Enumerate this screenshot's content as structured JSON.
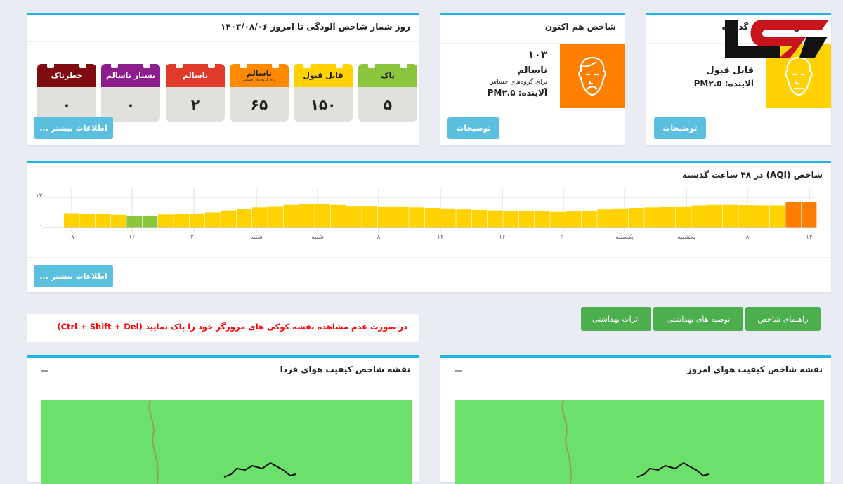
{
  "counter": {
    "title": "روز شمار شاخص آلودگی تا امروز ۱۴۰۳/۰۸/۰۶",
    "more_label": "اطلاعات بیشتر ...",
    "tiles": [
      {
        "label": "پاک",
        "sub": "",
        "value": "۵",
        "color": "#8cc63f",
        "text": "#222"
      },
      {
        "label": "قابل قبول",
        "sub": "",
        "value": "۱۵۰",
        "color": "#ffd200",
        "text": "#222"
      },
      {
        "label": "ناسالم",
        "sub": "برای گروه های حساس",
        "value": "۶۵",
        "color": "#ff8a00",
        "text": "#222"
      },
      {
        "label": "ناسالم",
        "sub": "",
        "value": "۲",
        "color": "#e03a2a",
        "text": "#fff"
      },
      {
        "label": "بسیار ناسالم",
        "sub": "",
        "value": "۰",
        "color": "#8e1e8e",
        "text": "#fff"
      },
      {
        "label": "خطرناک",
        "sub": "",
        "value": "۰",
        "color": "#7e0c10",
        "text": "#fff"
      }
    ]
  },
  "now": {
    "title": "شاخص هم اکنون",
    "value": "۱۰۳",
    "status": "ناسالم",
    "group": "برای گروه‌های حساس",
    "pollutant": "آلاینده: PM۲.۵",
    "button": "توضیحات",
    "color": "#ff8000",
    "face": "sad-face-icon"
  },
  "past24": {
    "title": "شاخص ۲۴ ساعت گذشته",
    "status": "قابل قبول",
    "pollutant": "آلاینده: PM۲.۵",
    "button": "توضیحات",
    "color": "#ffd200",
    "face": "neutral-face-icon"
  },
  "logo": {
    "text": "رکنا"
  },
  "chart_data": {
    "type": "bar",
    "title": "شاخص (AQI) در ۴۸ ساعت گذشته",
    "ylim": [
      0,
      120
    ],
    "yticks": [
      "۰",
      "۱۲۰"
    ],
    "xticks": [
      "۱۷",
      "۱۶",
      "۲۰",
      "شنبه",
      "شنبه",
      "۸",
      "۱۲",
      "۱۶",
      "۲۰",
      "یکشنبه",
      "یکشنبه",
      "۸",
      "۱۲"
    ],
    "values": [
      57,
      55,
      53,
      51,
      45,
      46,
      52,
      54,
      56,
      60,
      68,
      75,
      80,
      85,
      90,
      92,
      92,
      90,
      86,
      86,
      84,
      84,
      80,
      78,
      76,
      72,
      70,
      68,
      66,
      65,
      65,
      62,
      64,
      66,
      72,
      76,
      78,
      80,
      82,
      84,
      88,
      90,
      90,
      89,
      88,
      88,
      103,
      103
    ],
    "colors": {
      "good": "#8cc63f",
      "moderate": "#ffd200",
      "sensitive": "#ff7e00"
    },
    "grid": true
  },
  "chart_more": "اطلاعات بیشتر ...",
  "tabs": [
    "راهنمای شاخص",
    "توصیه های بهداشتی",
    "اثرات بهداشتی"
  ],
  "notice": "در صورت عدم مشاهده نقشه کوکی های مرورگر خود را پاک نمایید (Ctrl + Shift + Del)",
  "maps": {
    "today": "نقشه شاخص کیفیت هوای امروز",
    "tomorrow": "نقشه شاخص کیفیت هوای فردا"
  }
}
